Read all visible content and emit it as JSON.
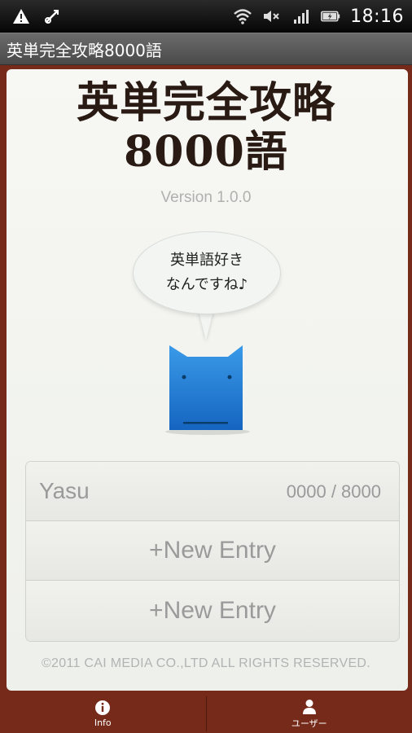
{
  "status_bar": {
    "time": "18:16",
    "icons": [
      "warning-icon",
      "usb-debug-icon",
      "wifi-icon",
      "mute-icon",
      "signal-icon",
      "battery-icon"
    ]
  },
  "title_bar": {
    "title": "英単完全攻略8000語"
  },
  "app": {
    "title_line1": "英単完全攻略",
    "title_line2": "8000語",
    "version": "Version 1.0.0"
  },
  "bubble": {
    "line1": "英単語好き",
    "line2": "なんですね♪"
  },
  "entries": [
    {
      "name": "Yasu",
      "progress": "0000 / 8000"
    },
    {
      "label": "+New Entry"
    },
    {
      "label": "+New Entry"
    }
  ],
  "copyright": "©2011 CAI MEDIA CO.,LTD ALL RIGHTS RESERVED.",
  "bottom_nav": [
    {
      "label": "Info",
      "icon": "info-icon"
    },
    {
      "label": "ユーザー",
      "icon": "user-icon"
    }
  ],
  "colors": {
    "frame": "#762b1a",
    "card": "#f2f3ef",
    "mascot": "#1f7fd1"
  }
}
